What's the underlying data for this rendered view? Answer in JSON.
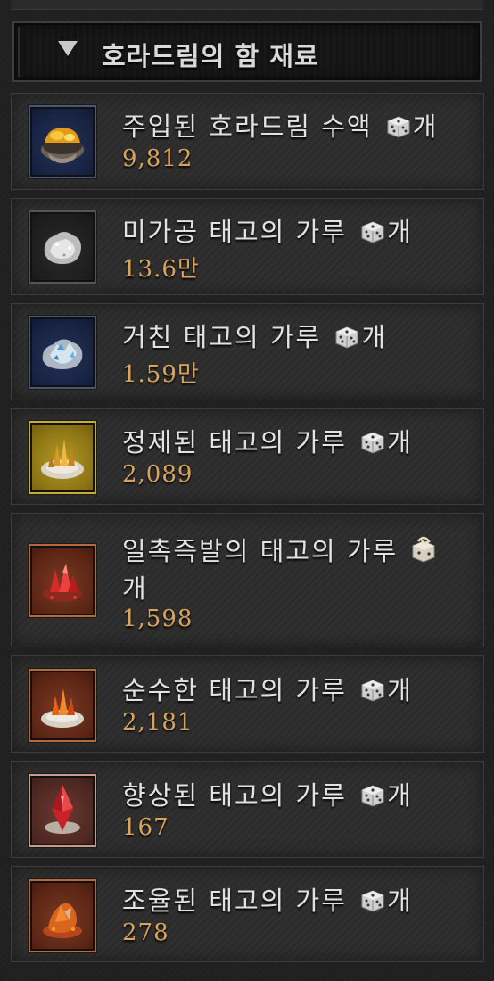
{
  "header": {
    "title": "호라드림의 함 재료"
  },
  "materials": [
    {
      "name": "주입된 호라드림 수액",
      "unit": "개",
      "count": "9,812",
      "rarity": "rare",
      "icon": "sap-bowl-icon"
    },
    {
      "name": "미가공 태고의 가루",
      "unit": "개",
      "count": "13.6만",
      "rarity": "common",
      "icon": "raw-dust-icon"
    },
    {
      "name": "거친 태고의 가루",
      "unit": "개",
      "count": "1.59만",
      "rarity": "rare",
      "icon": "coarse-dust-icon"
    },
    {
      "name": "정제된 태고의 가루",
      "unit": "개",
      "count": "2,089",
      "rarity": "legend",
      "icon": "refined-dust-icon"
    },
    {
      "name": "일촉즉발의 태고의 가루",
      "unit": "개",
      "count": "1,598",
      "rarity": "unique",
      "icon": "volatile-dust-icon"
    },
    {
      "name": "순수한 태고의 가루",
      "unit": "개",
      "count": "2,181",
      "rarity": "unique",
      "icon": "pure-dust-icon"
    },
    {
      "name": "향상된 태고의 가루",
      "unit": "개",
      "count": "167",
      "rarity": "mythic",
      "icon": "enhanced-dust-icon"
    },
    {
      "name": "조율된 태고의 가루",
      "unit": "개",
      "count": "278",
      "rarity": "unique",
      "icon": "tuned-dust-icon"
    }
  ]
}
